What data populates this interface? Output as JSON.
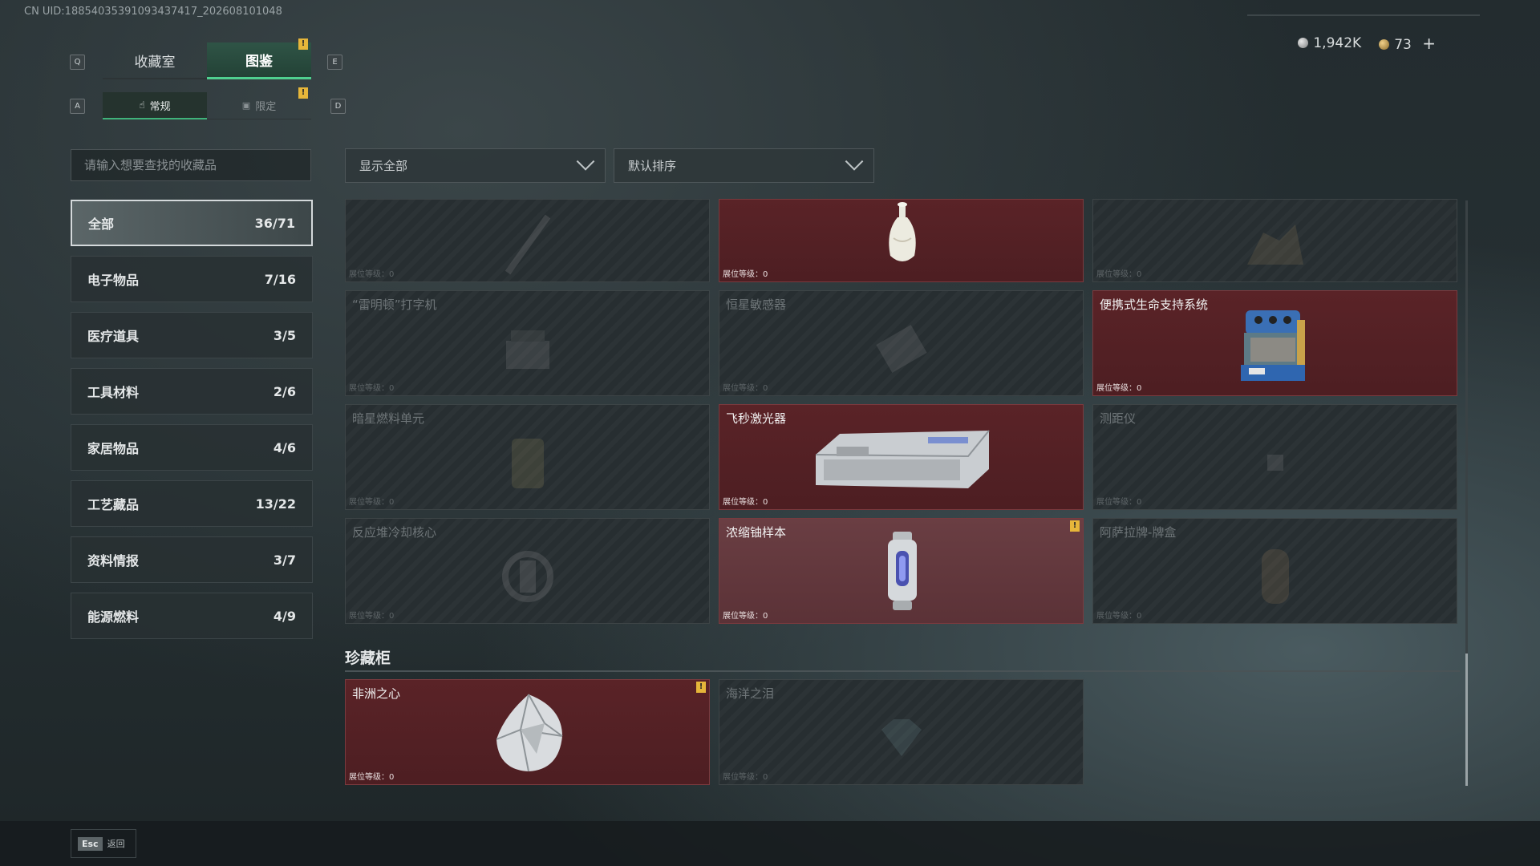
{
  "uid": "CN UID:18854035391093437417_202608101048",
  "keys": {
    "q": "Q",
    "e": "E",
    "a": "A",
    "d": "D"
  },
  "tabs": [
    {
      "label": "收藏室"
    },
    {
      "label": "图鉴"
    }
  ],
  "subtabs": [
    {
      "label": "常规"
    },
    {
      "label": "限定"
    }
  ],
  "alert_mark": "!",
  "currency": {
    "silver": "1,942K",
    "gold": "73",
    "add": "+"
  },
  "search": {
    "placeholder": "请输入想要查找的收藏品"
  },
  "categories": [
    {
      "label": "全部",
      "count": "36/71"
    },
    {
      "label": "电子物品",
      "count": "7/16"
    },
    {
      "label": "医疗道具",
      "count": "3/5"
    },
    {
      "label": "工具材料",
      "count": "2/6"
    },
    {
      "label": "家居物品",
      "count": "4/6"
    },
    {
      "label": "工艺藏品",
      "count": "13/22"
    },
    {
      "label": "资料情报",
      "count": "3/7"
    },
    {
      "label": "能源燃料",
      "count": "4/9"
    }
  ],
  "filters": {
    "show": "显示全部",
    "sort": "默认排序"
  },
  "level_label": "展位等级：0",
  "items": [
    {
      "name": "",
      "owned": false,
      "icon": "pen-icon"
    },
    {
      "name": "",
      "owned": true,
      "icon": "vase-icon"
    },
    {
      "name": "",
      "owned": false,
      "icon": "statue-icon"
    },
    {
      "name": "“雷明顿”打字机",
      "owned": false,
      "icon": "typewriter-icon"
    },
    {
      "name": "恒星敏感器",
      "owned": false,
      "icon": "sensor-icon"
    },
    {
      "name": "便携式生命支持系统",
      "owned": true,
      "icon": "life-support-icon"
    },
    {
      "name": "暗星燃料单元",
      "owned": false,
      "icon": "fuel-cell-icon"
    },
    {
      "name": "飞秒激光器",
      "owned": true,
      "icon": "laser-icon"
    },
    {
      "name": "测距仪",
      "owned": false,
      "icon": "rangefinder-icon"
    },
    {
      "name": "反应堆冷却核心",
      "owned": false,
      "icon": "reactor-core-icon"
    },
    {
      "name": "浓缩铀样本",
      "owned": true,
      "icon": "uranium-icon",
      "alert": true
    },
    {
      "name": "阿萨拉牌-牌盒",
      "owned": false,
      "icon": "card-box-icon"
    }
  ],
  "section": {
    "title": "珍藏柜"
  },
  "treasures": [
    {
      "name": "非洲之心",
      "owned": true,
      "icon": "diamond-icon",
      "alert": true
    },
    {
      "name": "海洋之泪",
      "owned": false,
      "icon": "gem-icon"
    }
  ],
  "footer": {
    "key": "Esc",
    "label": "返回"
  }
}
